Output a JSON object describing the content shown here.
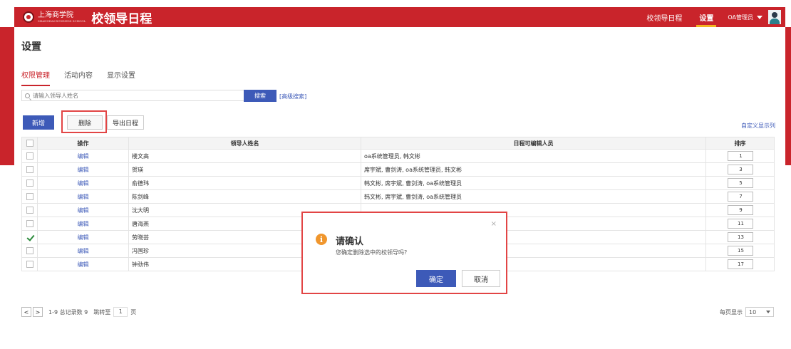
{
  "header": {
    "school_name": "上海商学院",
    "school_name_en": "SHANGHAI BUSINESS SCHOOL",
    "app_title": "校领导日程",
    "nav": [
      "校领导日程",
      "设置"
    ],
    "active_nav": "设置",
    "user_label": "OA管理员",
    "colors": {
      "brand": "#c9242b",
      "accent": "#f2b51f"
    }
  },
  "page": {
    "title": "设置",
    "tabs": [
      "权限管理",
      "活动内容",
      "显示设置"
    ],
    "active_tab": "权限管理"
  },
  "search": {
    "placeholder": "请输入领导人姓名",
    "button_label": "搜索",
    "advanced_link": "[高级搜索]"
  },
  "toolbar": {
    "add_label": "新增",
    "delete_label": "删除",
    "export_label": "导出日程",
    "custom_columns_label": "自定义显示列"
  },
  "table": {
    "headers": [
      "",
      "操作",
      "领导人姓名",
      "日程可编辑人员",
      "排序"
    ],
    "rows": [
      {
        "checked": false,
        "action": "编辑",
        "name": "楼文高",
        "editors": "oa系统管理员, 韩文彬",
        "order": "1"
      },
      {
        "checked": false,
        "action": "编辑",
        "name": "贺瑛",
        "editors": "席宇斌, 曹剑涛, oa系统管理员, 韩文彬",
        "order": "3"
      },
      {
        "checked": false,
        "action": "编辑",
        "name": "俞德玮",
        "editors": "韩文彬, 席宇斌, 曹剑涛, oa系统管理员",
        "order": "5"
      },
      {
        "checked": false,
        "action": "编辑",
        "name": "陈剑峰",
        "editors": "韩文彬, 席宇斌, 曹剑涛, oa系统管理员",
        "order": "7"
      },
      {
        "checked": false,
        "action": "编辑",
        "name": "沈大明",
        "editors": "",
        "order": "9"
      },
      {
        "checked": false,
        "action": "编辑",
        "name": "唐海燕",
        "editors": "",
        "order": "11"
      },
      {
        "checked": true,
        "action": "编辑",
        "name": "劳晓芸",
        "editors": "",
        "order": "13"
      },
      {
        "checked": false,
        "action": "编辑",
        "name": "冯国珍",
        "editors": "",
        "order": "15"
      },
      {
        "checked": false,
        "action": "编辑",
        "name": "钟劲伟",
        "editors": "",
        "order": "17"
      }
    ]
  },
  "pager": {
    "prev": "<",
    "next": ">",
    "summary": "1-9 总记录数 9",
    "jump_label": "跳转至",
    "jump_value": "1",
    "page_unit": "页",
    "per_page_label": "每页显示",
    "per_page_value": "10"
  },
  "dialog": {
    "close": "×",
    "icon": "i",
    "title": "请确认",
    "message": "您确定删除选中的校领导吗?",
    "ok_label": "确定",
    "cancel_label": "取消"
  }
}
